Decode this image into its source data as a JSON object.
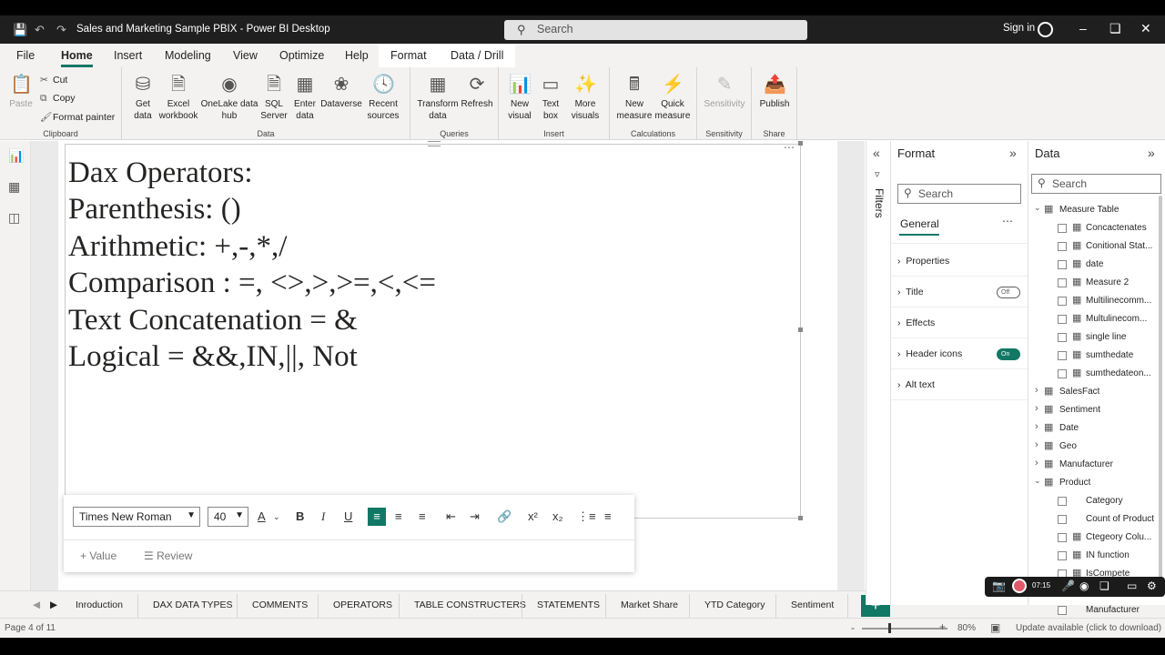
{
  "app": {
    "title": "Sales and Marketing Sample PBIX - Power BI Desktop",
    "search_placeholder": "Search",
    "signin": "Sign in"
  },
  "menu": {
    "tabs": [
      "File",
      "Home",
      "Insert",
      "Modeling",
      "View",
      "Optimize",
      "Help",
      "Format",
      "Data / Drill"
    ],
    "active": "Home"
  },
  "ribbon": {
    "clipboard": {
      "paste": "Paste",
      "cut": "Cut",
      "copy": "Copy",
      "format_painter": "Format painter",
      "label": "Clipboard"
    },
    "data": {
      "get_data": "Get data",
      "excel": "Excel workbook",
      "onelake": "OneLake data hub",
      "sql": "SQL Server",
      "enter": "Enter data",
      "dataverse": "Dataverse",
      "recent": "Recent sources",
      "label": "Data"
    },
    "queries": {
      "transform": "Transform data",
      "refresh": "Refresh",
      "label": "Queries"
    },
    "insert": {
      "new_visual": "New visual",
      "text_box": "Text box",
      "more_visuals": "More visuals",
      "label": "Insert"
    },
    "calculations": {
      "new_measure": "New measure",
      "quick_measure": "Quick measure",
      "label": "Calculations"
    },
    "sensitivity": {
      "sensitivity": "Sensitivity",
      "label": "Sensitivity"
    },
    "share": {
      "publish": "Publish",
      "label": "Share"
    }
  },
  "canvas": {
    "lines": [
      "Dax Operators:",
      "Parenthesis: ()",
      "Arithmetic: +,-,*,/",
      "Comparison : =, <>,>,>=,<,<=",
      "Text Concatenation = &",
      "Logical = &&,IN,||, Not"
    ]
  },
  "format_toolbar": {
    "font": "Times New Roman",
    "size": "40",
    "value_label": "Value",
    "review_label": "Review"
  },
  "page_tabs": {
    "tabs": [
      "Inroduction",
      "DAX DATA TYPES",
      "COMMENTS",
      "OPERATORS",
      "TABLE CONSTRUCTERS",
      "STATEMENTS",
      "Market Share",
      "YTD Category",
      "Sentiment"
    ],
    "active": "OPERATORS"
  },
  "status": {
    "page": "Page 4 of 11",
    "zoom": "80%",
    "update": "Update available (click to download)"
  },
  "filters": {
    "label": "Filters"
  },
  "format_pane": {
    "title": "Format",
    "search_placeholder": "Search",
    "tab": "General",
    "sections": [
      {
        "label": "Properties"
      },
      {
        "label": "Title",
        "toggle": "Off"
      },
      {
        "label": "Effects"
      },
      {
        "label": "Header icons",
        "toggle": "On"
      },
      {
        "label": "Alt text"
      }
    ]
  },
  "data_pane": {
    "title": "Data",
    "search_placeholder": "Search",
    "measure_table": {
      "name": "Measure Table",
      "items": [
        "Concactenates",
        "Conitional Stat...",
        "date",
        "Measure 2",
        "Multilinecomm...",
        "Multulinecom...",
        "single line",
        "sumthedate",
        "sumthedateon..."
      ]
    },
    "tables": [
      "SalesFact",
      "Sentiment",
      "Date",
      "Geo",
      "Manufacturer"
    ],
    "product": {
      "name": "Product",
      "items": [
        "Category",
        "Count of Product",
        "Ctegeory Colu...",
        "IN function",
        "IsCompete",
        "Manufacturer"
      ]
    }
  },
  "recorder": {
    "time": "07:15"
  }
}
